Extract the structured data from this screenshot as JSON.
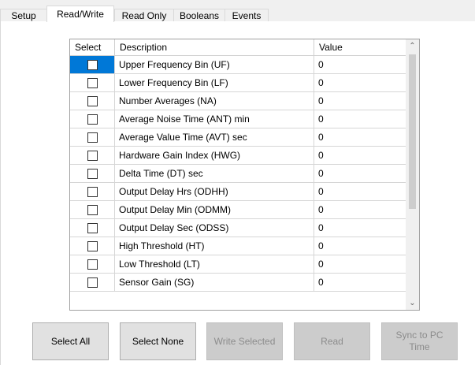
{
  "tabs": [
    {
      "label": "Setup",
      "selected": false
    },
    {
      "label": "Read/Write",
      "selected": true
    },
    {
      "label": "Read Only",
      "selected": false
    },
    {
      "label": "Booleans",
      "selected": false
    },
    {
      "label": "Events",
      "selected": false
    }
  ],
  "grid": {
    "columns": {
      "select": "Select",
      "description": "Description",
      "value": "Value"
    },
    "rows": [
      {
        "description": "Upper Frequency Bin (UF)",
        "value": "0",
        "checked": false,
        "active": true
      },
      {
        "description": "Lower Frequency Bin (LF)",
        "value": "0",
        "checked": false
      },
      {
        "description": "Number Averages (NA)",
        "value": "0",
        "checked": false
      },
      {
        "description": "Average Noise Time (ANT) min",
        "value": "0",
        "checked": false
      },
      {
        "description": "Average Value Time (AVT) sec",
        "value": "0",
        "checked": false
      },
      {
        "description": "Hardware Gain Index (HWG)",
        "value": "0",
        "checked": false
      },
      {
        "description": "Delta Time (DT) sec",
        "value": "0",
        "checked": false
      },
      {
        "description": "Output Delay Hrs (ODHH)",
        "value": "0",
        "checked": false
      },
      {
        "description": "Output Delay Min (ODMM)",
        "value": "0",
        "checked": false
      },
      {
        "description": "Output Delay Sec (ODSS)",
        "value": "0",
        "checked": false
      },
      {
        "description": "High Threshold (HT)",
        "value": "0",
        "checked": false
      },
      {
        "description": "Low Threshold (LT)",
        "value": "0",
        "checked": false
      },
      {
        "description": "Sensor Gain (SG)",
        "value": "0",
        "checked": false
      }
    ]
  },
  "scrollbar": {
    "up_icon": "chevron-up-icon",
    "down_icon": "chevron-down-icon"
  },
  "buttons": {
    "select_all": {
      "label": "Select All",
      "enabled": true
    },
    "select_none": {
      "label": "Select None",
      "enabled": true
    },
    "write_selected": {
      "label": "Write Selected",
      "enabled": false
    },
    "read": {
      "label": "Read",
      "enabled": false
    },
    "sync_pc_time": {
      "label": "Sync to PC Time",
      "enabled": false
    }
  }
}
